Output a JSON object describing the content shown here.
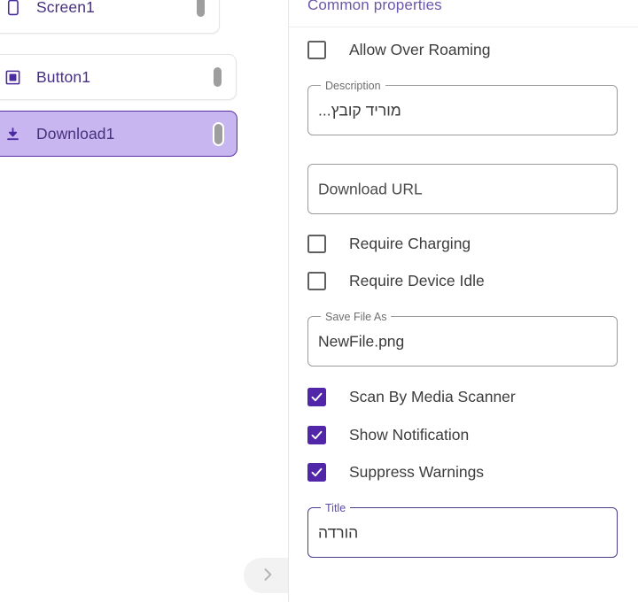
{
  "left_panel": {
    "tree_items": [
      {
        "label": "Screen1",
        "icon": "screen-icon",
        "selected": false
      },
      {
        "label": "Button1",
        "icon": "button-icon",
        "selected": false
      },
      {
        "label": "Download1",
        "icon": "download-icon",
        "selected": true
      }
    ],
    "next_button_icon": "chevron-right-icon"
  },
  "properties_panel": {
    "header": "Common properties",
    "checkboxes": [
      {
        "label": "Allow Over Roaming",
        "checked": false
      },
      {
        "label": "Require Charging",
        "checked": false
      },
      {
        "label": "Require Device Idle",
        "checked": false
      },
      {
        "label": "Scan By Media Scanner",
        "checked": true
      },
      {
        "label": "Show Notification",
        "checked": true
      },
      {
        "label": "Suppress Warnings",
        "checked": true
      }
    ],
    "fields": {
      "description": {
        "legend": "Description",
        "value": "מוריד קובץ...",
        "focused": false
      },
      "download_url": {
        "legend": "",
        "value": "Download URL",
        "focused": false
      },
      "save_file_as": {
        "legend": "Save File As",
        "value": "NewFile.png",
        "focused": false
      },
      "title": {
        "legend": "Title",
        "value": "הורדה",
        "focused": true
      }
    }
  },
  "colors": {
    "accent_purple": "#5226a8",
    "selected_row_bg": "#c7b6f0",
    "selected_row_border": "#5a30a8",
    "tree_label": "#46307f",
    "header_purple": "#6b57a8",
    "field_border": "#9b9b9b",
    "field_border_focused": "#4b3b8f"
  }
}
